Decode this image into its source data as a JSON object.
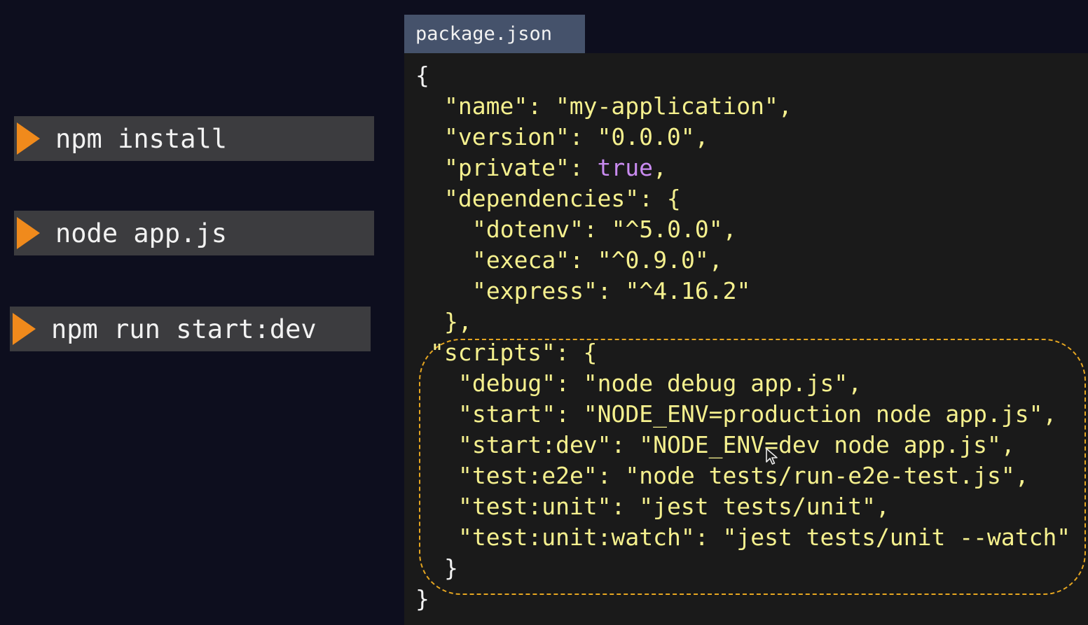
{
  "commands": [
    {
      "label": "npm install"
    },
    {
      "label": "node app.js"
    },
    {
      "label": "npm run start:dev"
    }
  ],
  "file_tab": {
    "title": "package.json"
  },
  "code_lines": {
    "l1": "{",
    "l2": "\"name\": \"my-application\",",
    "l3": "\"version\": \"0.0.0\",",
    "l4_key": "\"private\": ",
    "l4_val": "true",
    "l4_end": ",",
    "l5": "\"dependencies\": {",
    "l6": "\"dotenv\": \"^5.0.0\",",
    "l7": "\"execa\": \"^0.9.0\",",
    "l8": "\"express\": \"^4.16.2\"",
    "l9": "},",
    "l10": "\"scripts\": {",
    "l11": "\"debug\": \"node debug app.js\",",
    "l12": "\"start\": \"NODE_ENV=production node app.js\",",
    "l13": "\"start:dev\": \"NODE_ENV=dev node app.js\",",
    "l14": "\"test:e2e\": \"node tests/run-e2e-test.js\",",
    "l15": "\"test:unit\": \"jest tests/unit\",",
    "l16": "\"test:unit:watch\": \"jest tests/unit --watch\"",
    "l17": "}",
    "l18": "}"
  },
  "colors": {
    "background": "#0d0e1e",
    "command_bar": "#3c3c3f",
    "play_icon": "#f08a1c",
    "tab": "#45526b",
    "code_bg": "#1a1a1a",
    "code_text": "#f5f08e",
    "keyword": "#c98bf0",
    "highlight_border": "#e6a620"
  },
  "icons": {
    "play": "play-triangle-icon",
    "cursor": "mouse-pointer-icon"
  }
}
